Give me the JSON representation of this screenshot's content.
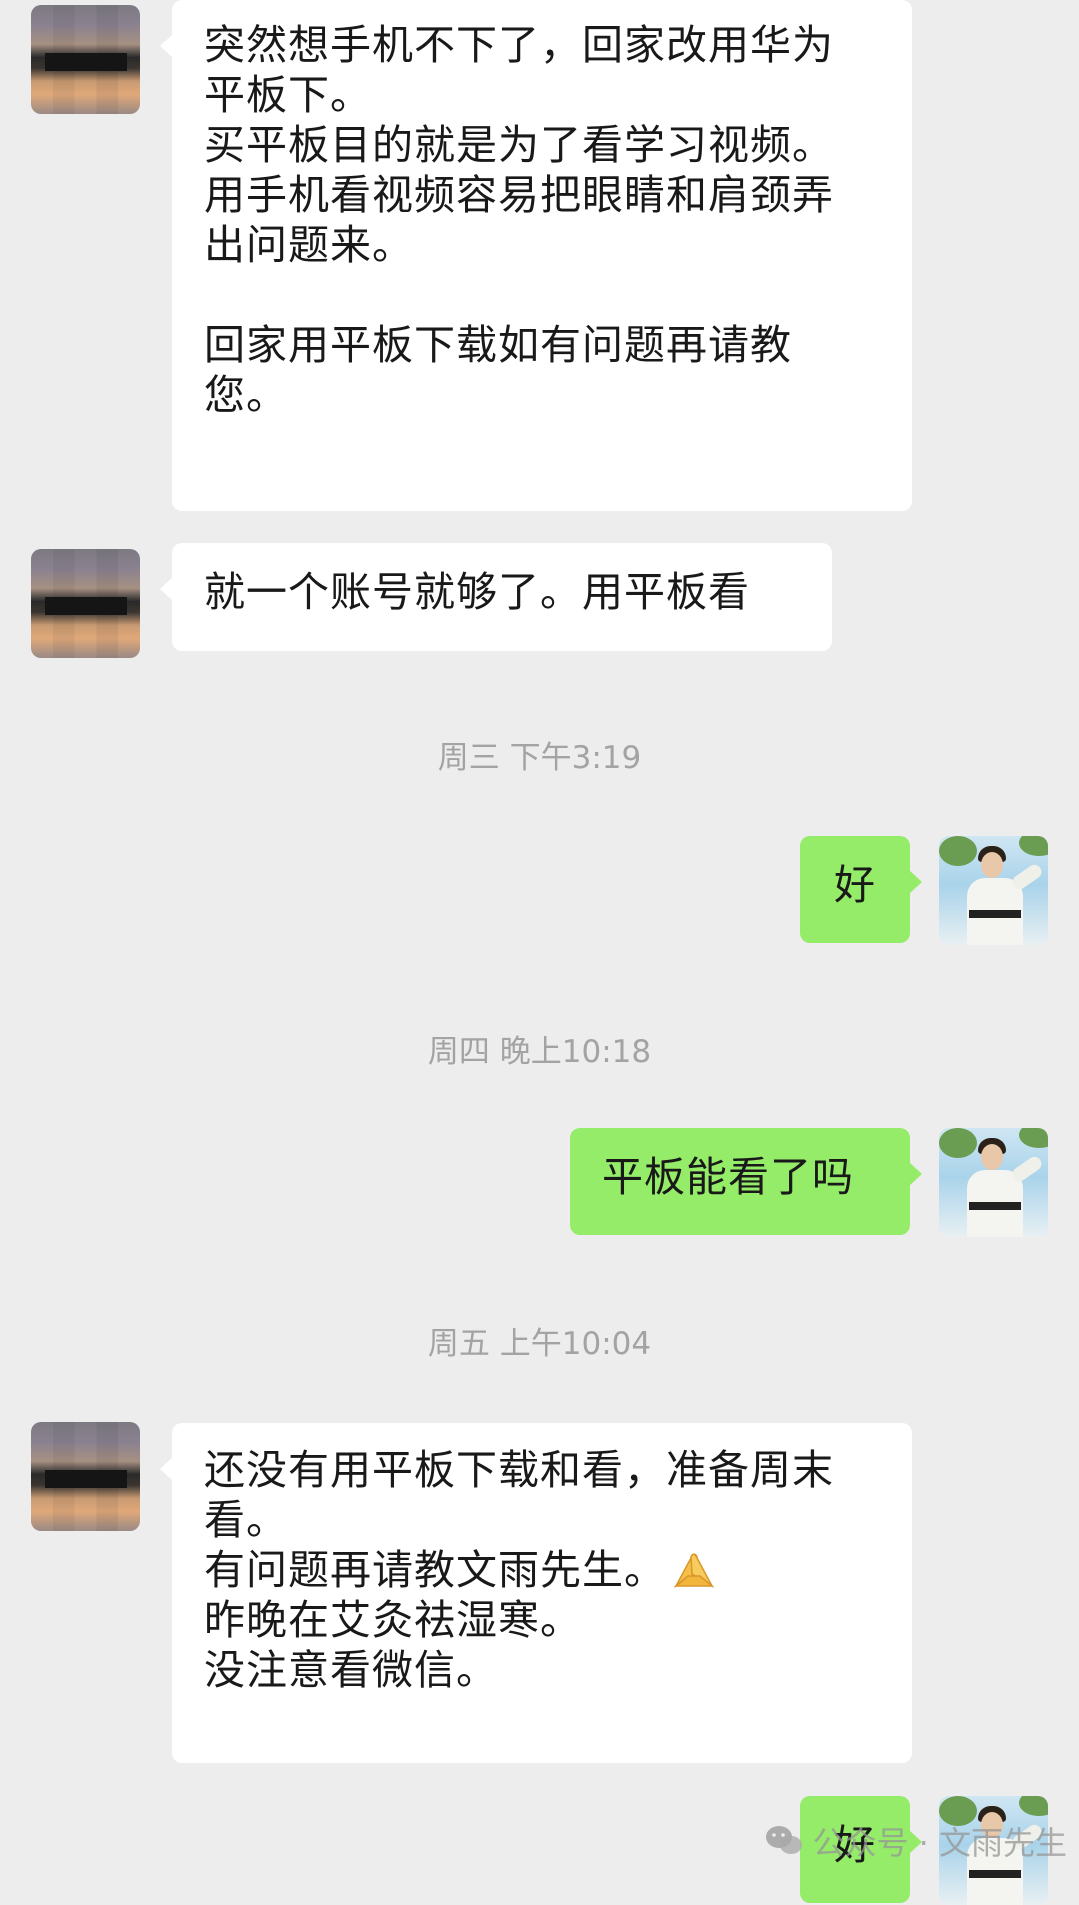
{
  "messages": [
    {
      "id": "m1",
      "direction": "incoming",
      "lines": [
        "突然想手机不下了，回家改用华为",
        "平板下。",
        "买平板目的就是为了看学习视频。",
        "用手机看视频容易把眼睛和肩颈弄",
        "出问题来。",
        "",
        "回家用平板下载如有问题再请教",
        "您。"
      ]
    },
    {
      "id": "m2",
      "direction": "incoming",
      "lines": [
        "就一个账号就够了。用平板看"
      ]
    },
    {
      "id": "m3",
      "direction": "outgoing",
      "lines": [
        "好"
      ]
    },
    {
      "id": "m4",
      "direction": "outgoing",
      "lines": [
        "平板能看了吗"
      ]
    },
    {
      "id": "m5",
      "direction": "incoming",
      "lines": [
        "还没有用平板下载和看，准备周末",
        "看。",
        "有问题再请教文雨先生。",
        "昨晚在艾灸祛湿寒。",
        "没注意看微信。"
      ],
      "emoji": "folded-hands"
    },
    {
      "id": "m6",
      "direction": "outgoing",
      "lines": [
        "好"
      ]
    }
  ],
  "timestamps": [
    "周三 下午3:19",
    "周四 晚上10:18",
    "周五 上午10:04"
  ],
  "watermark": "公众号 · 文雨先生",
  "colors": {
    "background": "#ededed",
    "incoming_bubble": "#ffffff",
    "outgoing_bubble": "#95ec69",
    "timestamp_text": "#a3a3a3"
  }
}
